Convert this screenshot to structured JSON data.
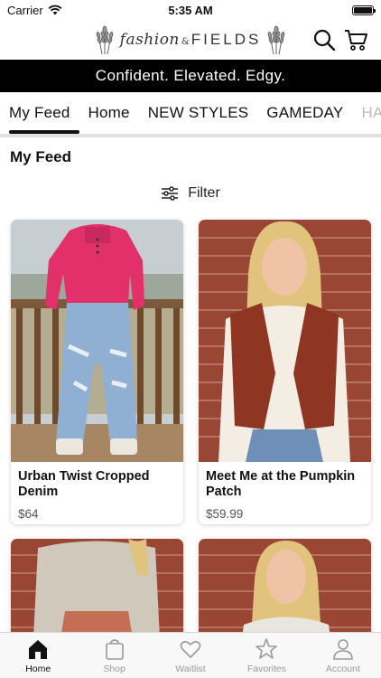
{
  "status_bar": {
    "carrier": "Carrier",
    "time": "5:35 AM"
  },
  "header": {
    "brand_script": "fashion",
    "brand_amp": "&",
    "brand_caps": "FIELDS",
    "icons": [
      "wheat-icon",
      "search-icon",
      "cart-icon"
    ]
  },
  "banner": {
    "text": "Confident. Elevated. Edgy."
  },
  "tabs": [
    {
      "label": "My Feed",
      "active": true
    },
    {
      "label": "Home"
    },
    {
      "label": "NEW STYLES"
    },
    {
      "label": "GAMEDAY"
    },
    {
      "label": "HA"
    }
  ],
  "section_title": "My Feed",
  "filter": {
    "label": "Filter",
    "icon": "sliders-icon"
  },
  "products": [
    {
      "name": "Urban Twist Cropped Denim",
      "price": "$64"
    },
    {
      "name": "Meet Me at the Pumpkin Patch",
      "price": "$59.99"
    }
  ],
  "tab_bar": [
    {
      "label": "Home",
      "icon": "home-icon",
      "active": true
    },
    {
      "label": "Shop",
      "icon": "bag-icon"
    },
    {
      "label": "Waitlist",
      "icon": "heart-icon"
    },
    {
      "label": "Favorites",
      "icon": "star-icon"
    },
    {
      "label": "Account",
      "icon": "person-icon"
    }
  ],
  "colors": {
    "banner_bg": "#000000",
    "text": "#111111",
    "inactive": "#9a9a9a",
    "price": "#555555"
  }
}
